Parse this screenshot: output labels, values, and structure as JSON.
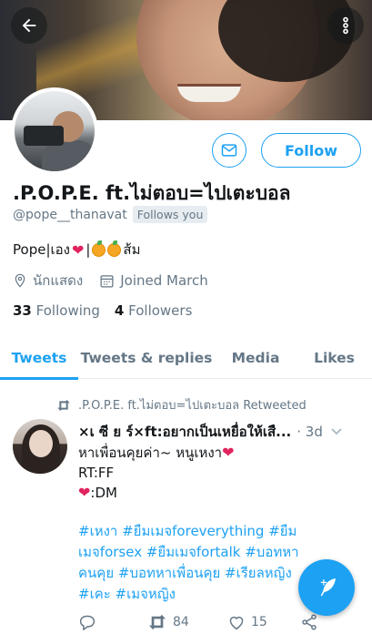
{
  "profile": {
    "display_name": ".P.O.P.E. ft.ไม่ตอบ=ไปเตะบอล",
    "handle": "@pope__thanavat",
    "follows_you_badge": "Follows you",
    "bio_prefix": "Pope|เอง",
    "bio_sep": "|",
    "bio_suffix": "ส้ม",
    "occupation": "นักแสดง",
    "joined": "Joined March",
    "following_count": "33",
    "following_label": "Following",
    "followers_count": "4",
    "followers_label": "Followers",
    "follow_button": "Follow"
  },
  "tabs": [
    "Tweets",
    "Tweets & replies",
    "Media",
    "Likes"
  ],
  "tweet": {
    "retweet_notice": ".P.O.P.E. ft.ไม่ตอบ=ไปเตะบอล Retweeted",
    "author": "×เ ซี ย ร์×ft:อยากเป็นเหยื่อให้เสื...",
    "time": "· 3d",
    "line1": "หาเพื่อนคุยค่า~ หนูเหงา",
    "line2": "RT:FF",
    "line3": ":DM",
    "hashtags": "#เหงา #ยืมเมจforeverything #ยืมเมจforsex #ยืมเมจfortalk #บอทหาคนคุย #บอทหาเพื่อนคุย #เรียลหญิง #เคะ #เมจหญิง",
    "retweets": "84",
    "likes": "15"
  },
  "colors": {
    "accent": "#1da1f2",
    "muted": "#657786",
    "heart": "#e0245e"
  }
}
